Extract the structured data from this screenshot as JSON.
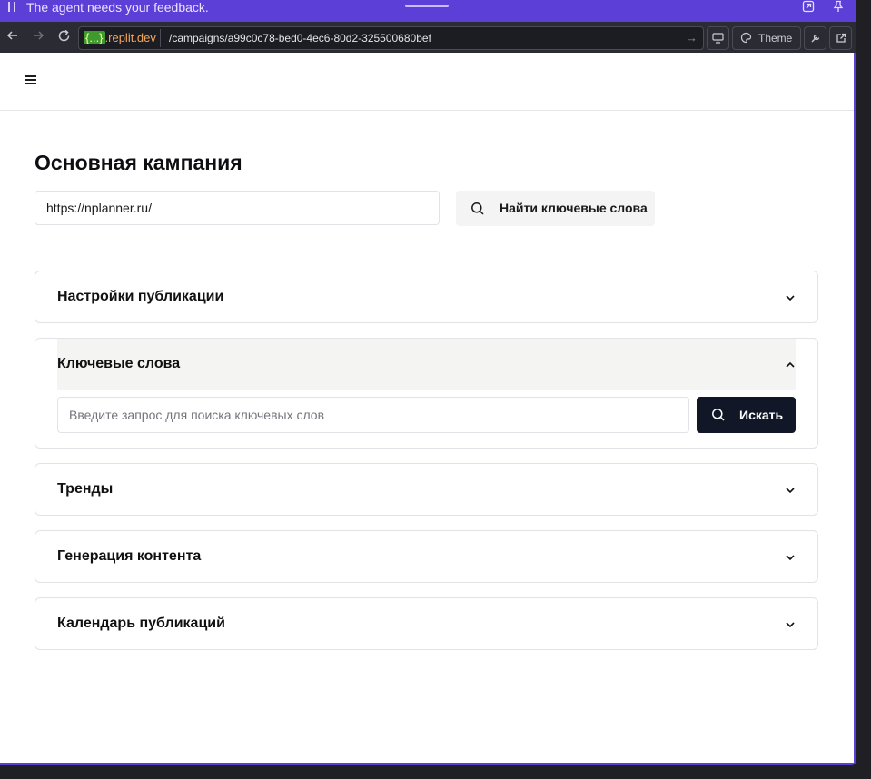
{
  "notification": {
    "message": "The agent needs your feedback."
  },
  "browser": {
    "domain_tag": "{...}",
    "domain": ".replit.dev",
    "path": "/campaigns/a99c0c78-bed0-4ec6-80d2-325500680bef",
    "theme_label": "Theme"
  },
  "page": {
    "title": "Основная кампания",
    "url_value": "https://nplanner.ru/",
    "find_button_label": "Найти ключевые слова"
  },
  "sections": {
    "publication_settings": "Настройки публикации",
    "keywords": {
      "title": "Ключевые слова",
      "search_placeholder": "Введите запрос для поиска ключевых слов",
      "search_button_label": "Искать"
    },
    "trends": "Тренды",
    "content_generation": "Генерация контента",
    "publication_calendar": "Календарь публикаций"
  },
  "colors": {
    "accent": "#5b3fd6",
    "primary_button": "#111726"
  }
}
